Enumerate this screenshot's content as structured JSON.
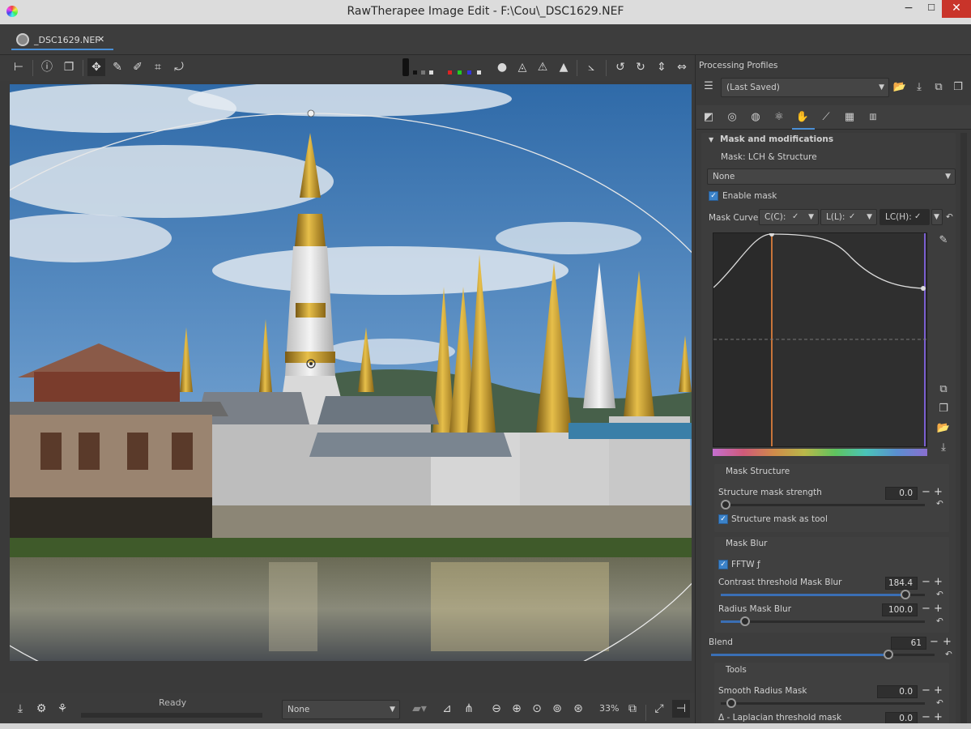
{
  "window": {
    "title": "RawTherapee Image Edit - F:\\Cou\\_DSC1629.NEF",
    "minimize": "−",
    "maximize": "☐",
    "close": "✕"
  },
  "file_tab": {
    "name": "_DSC1629.NEF",
    "close": "✕"
  },
  "status": {
    "text": "Ready"
  },
  "bottom": {
    "profile_combo": "None",
    "zoom": "33%"
  },
  "panel": {
    "header": "Processing Profiles",
    "profile_value": "(Last Saved)",
    "section_title": "Mask and modifications",
    "mask_label": "Mask: LCH & Structure",
    "mask_combo": "None",
    "enable_mask": "Enable mask",
    "mask_curves_label": "Mask Curves",
    "curve_tabs": [
      "C(C):",
      "L(L):",
      "LC(H):"
    ],
    "mask_structure_title": "Mask Structure",
    "structure_strength_label": "Structure mask strength",
    "structure_strength_value": "0.0",
    "structure_as_tool": "Structure mask as tool",
    "mask_blur_title": "Mask Blur",
    "fftw_label": "FFTW ƒ",
    "contrast_threshold_label": "Contrast threshold Mask Blur",
    "contrast_threshold_value": "184.4",
    "radius_blur_label": "Radius Mask Blur",
    "radius_blur_value": "100.0",
    "blend_label": "Blend",
    "blend_value": "61",
    "tools_title": "Tools",
    "smooth_radius_label": "Smooth Radius Mask",
    "smooth_radius_value": "0.0",
    "laplacian_label": "Δ - Laplacian threshold mask",
    "laplacian_value": "0.0"
  },
  "sliders": {
    "structure_strength": 0.0,
    "contrast_threshold": 0.92,
    "radius_blur": 0.12,
    "blend": 0.8,
    "smooth_radius": 0.0
  }
}
